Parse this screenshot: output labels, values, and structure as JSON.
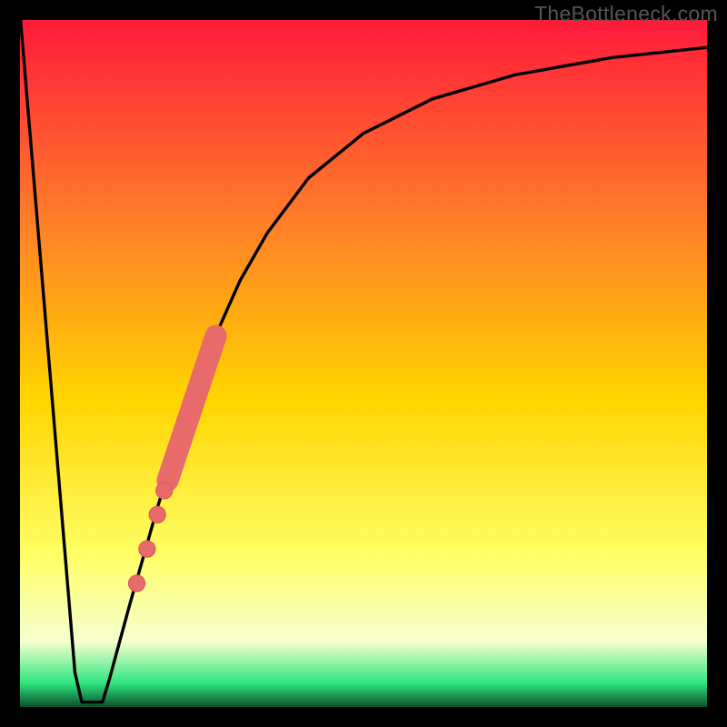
{
  "watermark": "TheBottleneck.com",
  "colors": {
    "frame": "#000000",
    "curve": "#000000",
    "dot_fill": "#e86a6a",
    "dot_stroke": "#d65c5c",
    "grad_top": "#ff1a3a",
    "grad_mid1": "#ff7a2a",
    "grad_mid2": "#ffd400",
    "grad_mid3": "#ffff66",
    "grad_pale": "#f6ffd0",
    "grad_green": "#2fe67f",
    "grad_bottom": "#0a4f2b"
  },
  "chart_data": {
    "type": "line",
    "title": "",
    "xlabel": "",
    "ylabel": "",
    "xlim": [
      0,
      100
    ],
    "ylim": [
      0,
      100
    ],
    "curve": [
      {
        "x": 0,
        "y": 101
      },
      {
        "x": 8,
        "y": 5
      },
      {
        "x": 9,
        "y": 0.7
      },
      {
        "x": 12,
        "y": 0.7
      },
      {
        "x": 13,
        "y": 4
      },
      {
        "x": 16,
        "y": 15
      },
      {
        "x": 18,
        "y": 22
      },
      {
        "x": 20,
        "y": 29
      },
      {
        "x": 24,
        "y": 42
      },
      {
        "x": 28,
        "y": 53
      },
      {
        "x": 32,
        "y": 62
      },
      {
        "x": 36,
        "y": 69
      },
      {
        "x": 42,
        "y": 77
      },
      {
        "x": 50,
        "y": 83.5
      },
      {
        "x": 60,
        "y": 88.5
      },
      {
        "x": 72,
        "y": 92
      },
      {
        "x": 86,
        "y": 94.5
      },
      {
        "x": 100,
        "y": 96
      }
    ],
    "dots": [
      {
        "x": 17.0,
        "y": 18.0,
        "r": 1.2
      },
      {
        "x": 18.5,
        "y": 23.0,
        "r": 1.2
      },
      {
        "x": 20.0,
        "y": 28.0,
        "r": 1.2
      },
      {
        "x": 21.0,
        "y": 31.5,
        "r": 1.2
      }
    ],
    "thick_band": {
      "p0": {
        "x": 21.5,
        "y": 33.0
      },
      "p1": {
        "x": 28.5,
        "y": 54.0
      },
      "r": 1.6
    },
    "gradient_stops": [
      {
        "offset": 0.0,
        "key": "grad_top"
      },
      {
        "offset": 0.28,
        "key": "grad_mid1"
      },
      {
        "offset": 0.55,
        "key": "grad_mid2"
      },
      {
        "offset": 0.78,
        "key": "grad_mid3"
      },
      {
        "offset": 0.905,
        "key": "grad_pale"
      },
      {
        "offset": 0.965,
        "key": "grad_green"
      },
      {
        "offset": 1.0,
        "key": "grad_bottom"
      }
    ]
  }
}
